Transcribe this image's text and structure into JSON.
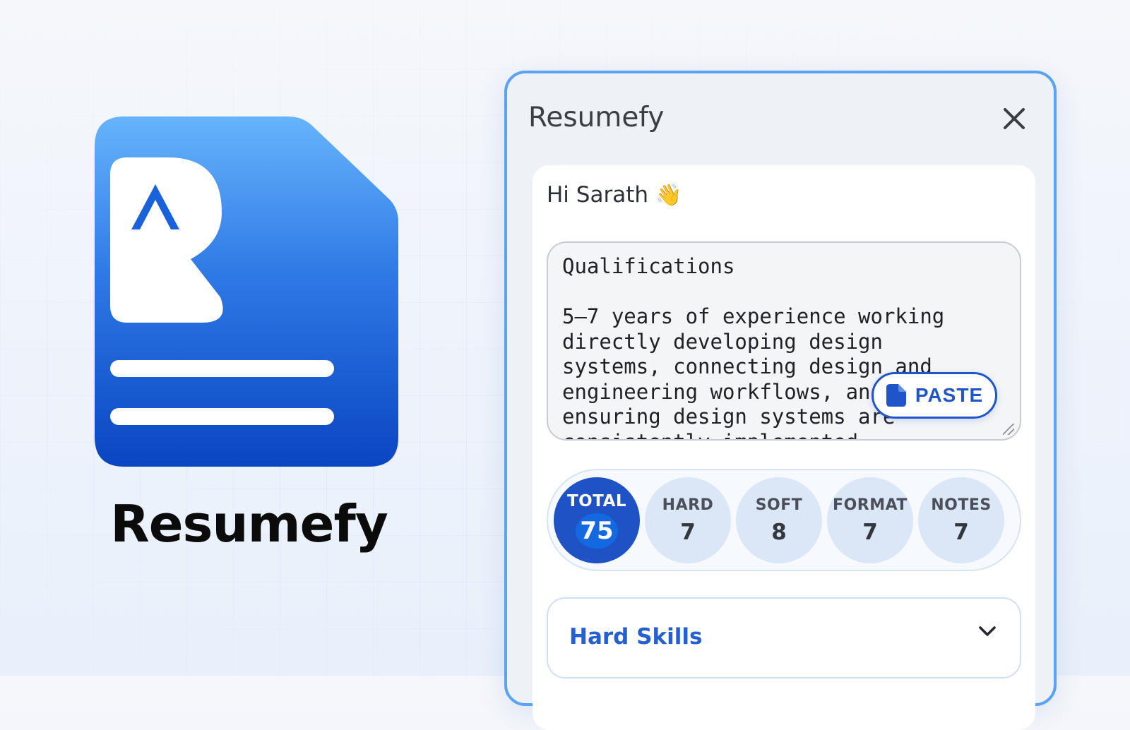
{
  "brand": {
    "name": "Resumefy",
    "colors": {
      "logo_top": "#63b1fb",
      "logo_bottom": "#0a47c4",
      "text": "#0b0b0c"
    }
  },
  "panel": {
    "title": "Resumefy",
    "close_icon": "close-icon",
    "border_color": "#5aa2f3",
    "greeting": {
      "text": "Hi Sarath",
      "emoji": "👋"
    },
    "job_description": {
      "value": "Qualifications\n\n5–7 years of experience working directly developing design systems, connecting design and engineering workflows, and ensuring design systems are consistently implemented"
    },
    "paste_button": {
      "label": "PASTE",
      "icon": "clipboard-icon"
    },
    "scores": [
      {
        "label": "TOTAL",
        "value": "75"
      },
      {
        "label": "HARD",
        "value": "7"
      },
      {
        "label": "SOFT",
        "value": "8"
      },
      {
        "label": "FORMAT",
        "value": "7"
      },
      {
        "label": "NOTES",
        "value": "7"
      }
    ],
    "accordion": {
      "title": "Hard Skills",
      "icon": "chevron-down-icon"
    },
    "accent_color": "#1f55c8"
  }
}
